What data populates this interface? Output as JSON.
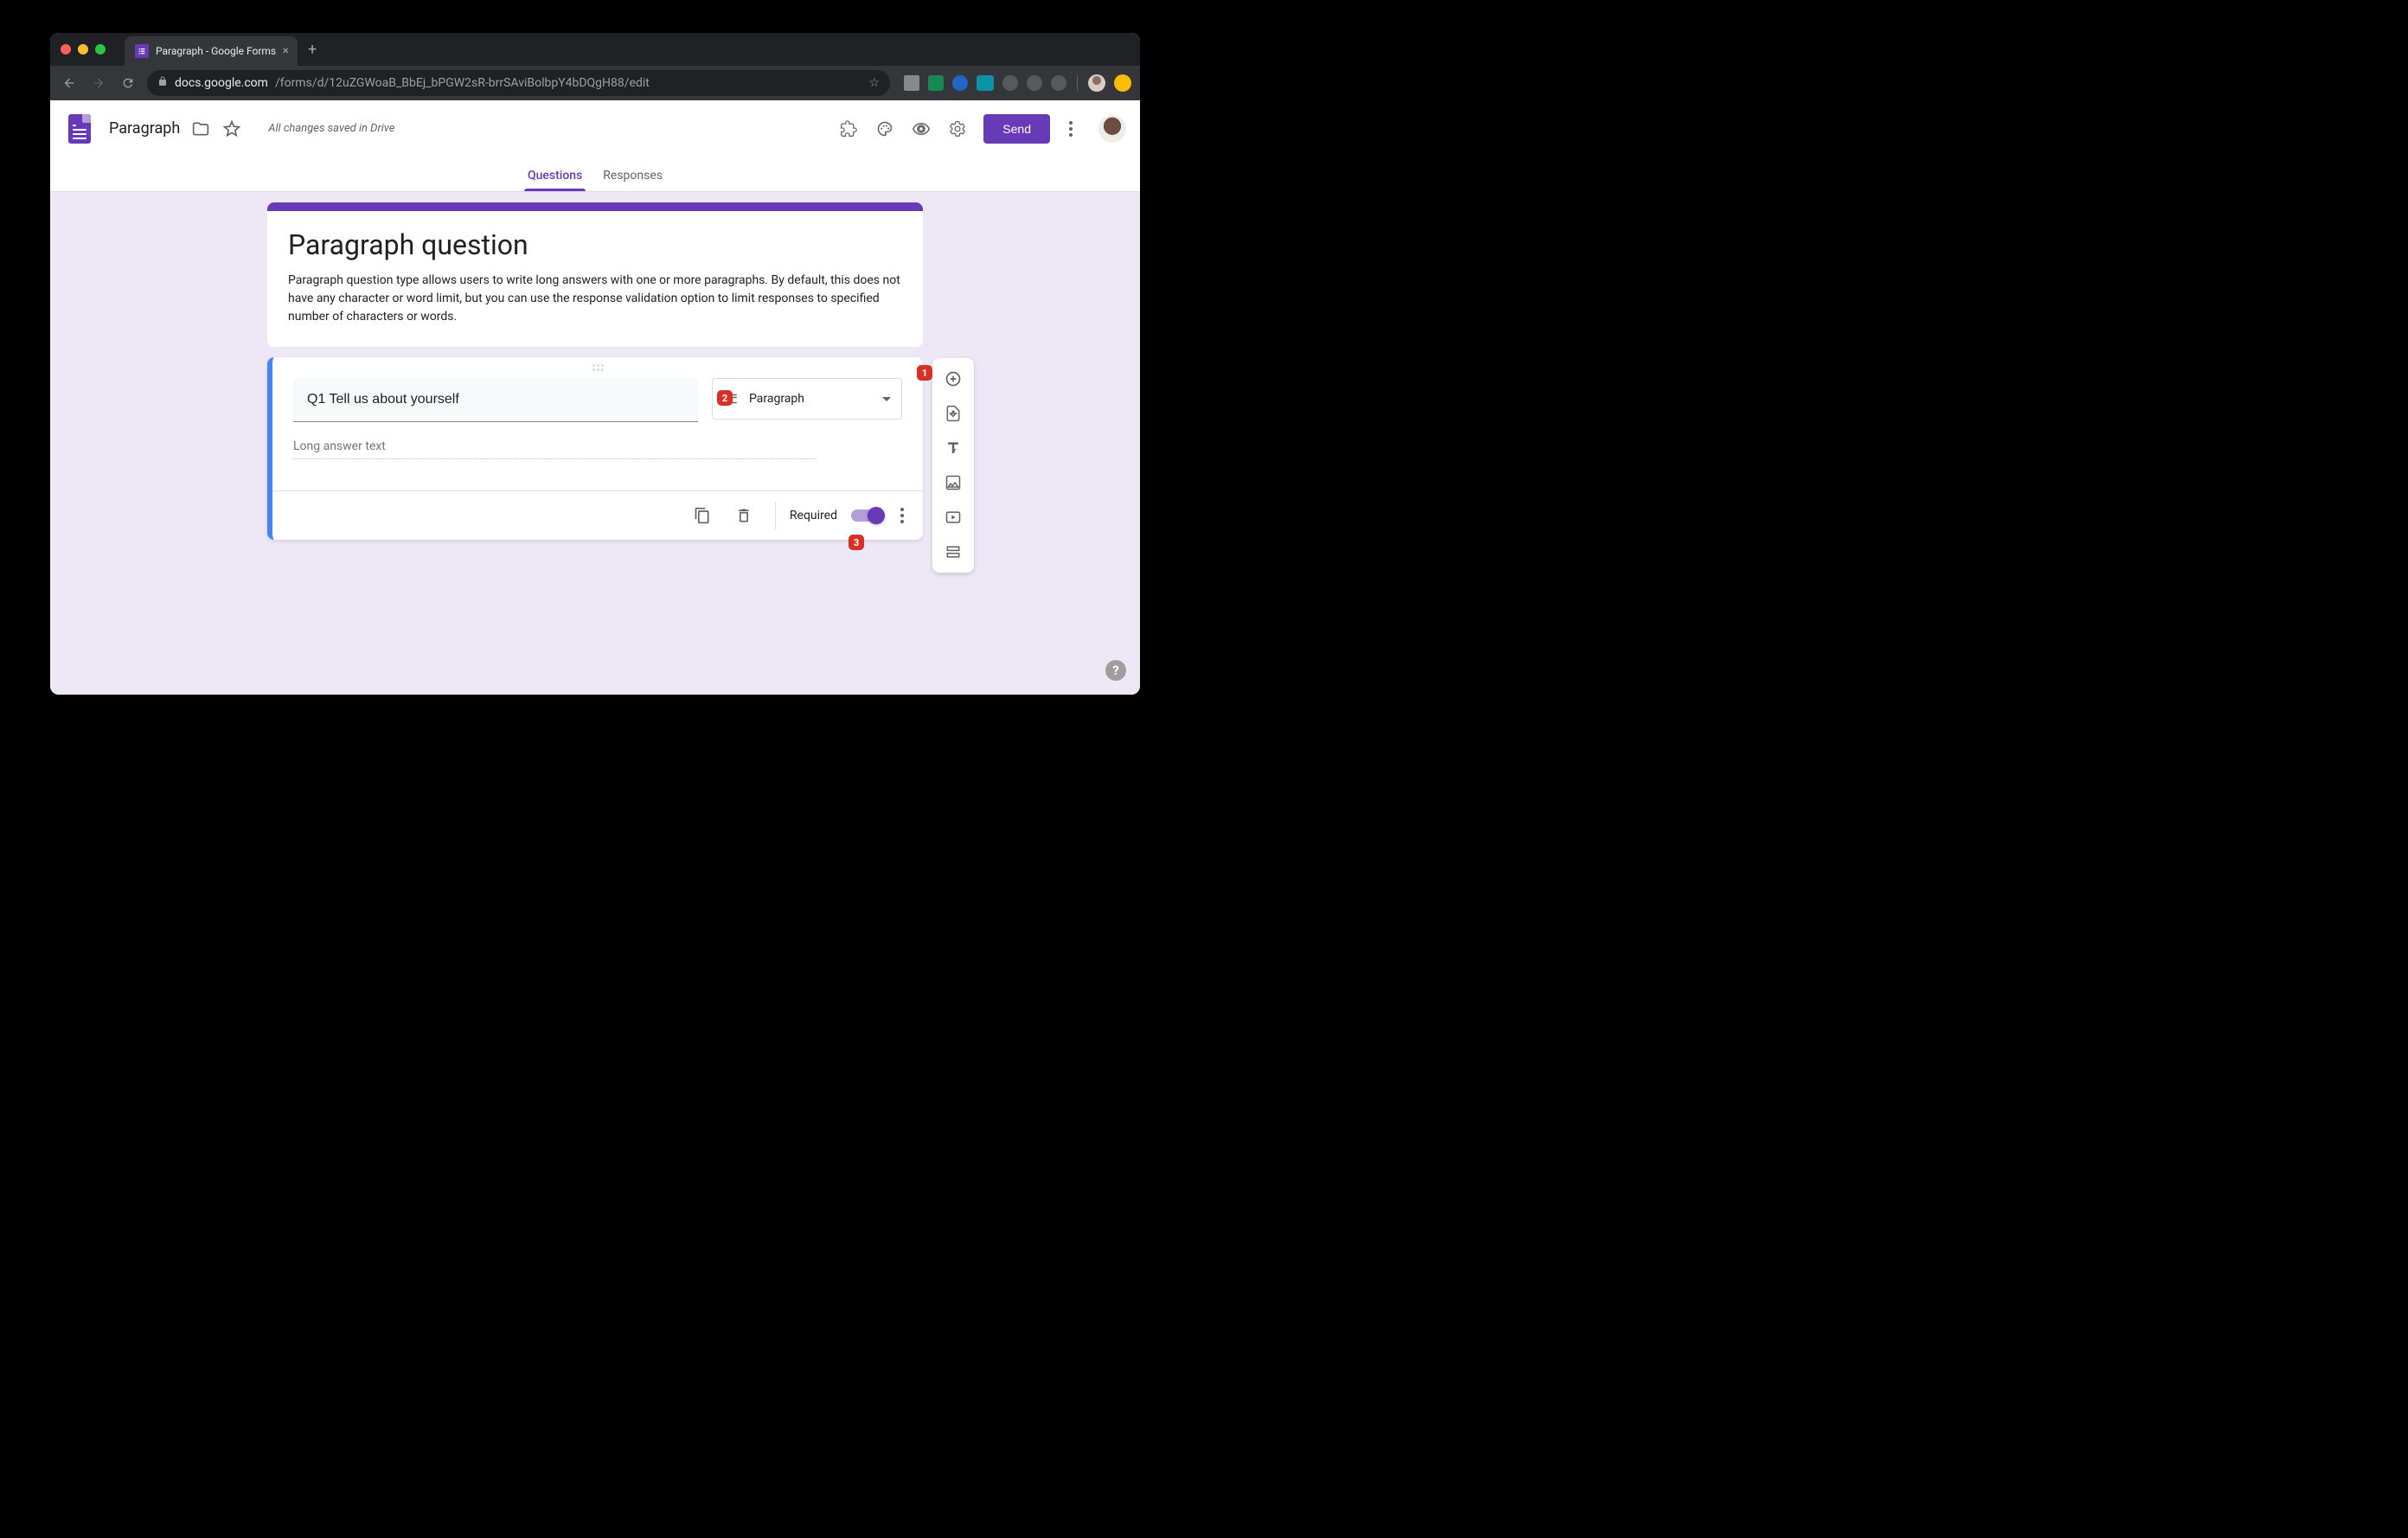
{
  "browser": {
    "tab_title": "Paragraph - Google Forms",
    "url_host": "docs.google.com",
    "url_path": "/forms/d/12uZGWoaB_BbEj_bPGW2sR-brrSAviBolbpY4bDQgH88/edit"
  },
  "header": {
    "doc_title": "Paragraph",
    "save_status": "All changes saved in Drive",
    "send_button": "Send"
  },
  "tabs": {
    "questions": "Questions",
    "responses": "Responses"
  },
  "form": {
    "title": "Paragraph question",
    "description": "Paragraph question type allows users to write long answers with one or more paragraphs. By default, this does not have any character or word limit, but you can use the response validation option to limit responses to specified number of characters or words."
  },
  "question": {
    "title": "Q1 Tell us about yourself",
    "type_label": "Paragraph",
    "answer_placeholder": "Long answer text",
    "required_label": "Required"
  },
  "annotations": {
    "a1": "1",
    "a2": "2",
    "a3": "3"
  },
  "help": "?"
}
